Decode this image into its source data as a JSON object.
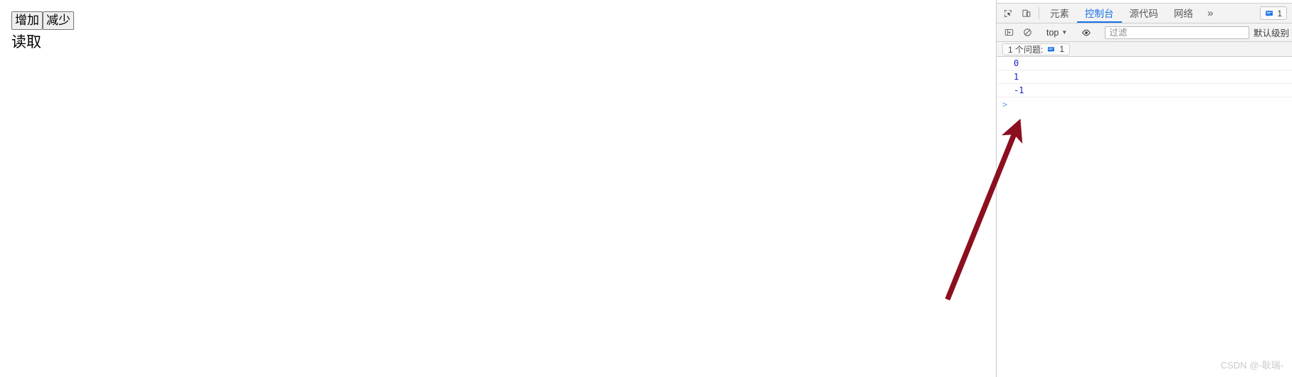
{
  "page": {
    "buttons": [
      {
        "label": "增加",
        "name": "increase-button"
      },
      {
        "label": "减少",
        "name": "decrease-button"
      }
    ],
    "read_label": "读取"
  },
  "devtools": {
    "toolbar_icons": [
      {
        "name": "inspect-element-icon",
        "title": "检查元素"
      },
      {
        "name": "device-toolbar-icon",
        "title": "切换设备工具栏"
      }
    ],
    "tabs": [
      {
        "label": "元素",
        "name": "tab-elements",
        "active": false
      },
      {
        "label": "控制台",
        "name": "tab-console",
        "active": true
      },
      {
        "label": "源代码",
        "name": "tab-sources",
        "active": false
      },
      {
        "label": "网络",
        "name": "tab-network",
        "active": false
      }
    ],
    "more_tabs_label": "»",
    "issues_badge_count": "1",
    "console_toolbar": {
      "sidebar_toggle_name": "console-sidebar-toggle-icon",
      "clear_console_name": "clear-console-icon",
      "context_label": "top",
      "context_caret": "▼",
      "live_expression_name": "eye-icon",
      "filter_placeholder": "过滤",
      "filter_value": "",
      "level_label": "默认级别"
    },
    "issues_bar": {
      "label": "1 个问题:",
      "count": "1"
    },
    "messages": [
      {
        "value": "0",
        "source": ""
      },
      {
        "value": "1",
        "source": ""
      },
      {
        "value": "-1",
        "source": ""
      }
    ],
    "prompt_caret": ">",
    "prompt_value": ""
  },
  "annotation": {
    "arrow_color": "#8b0f1e",
    "arrow_target": "prompt-row"
  },
  "watermark": "CSDN @-耿瑞-"
}
